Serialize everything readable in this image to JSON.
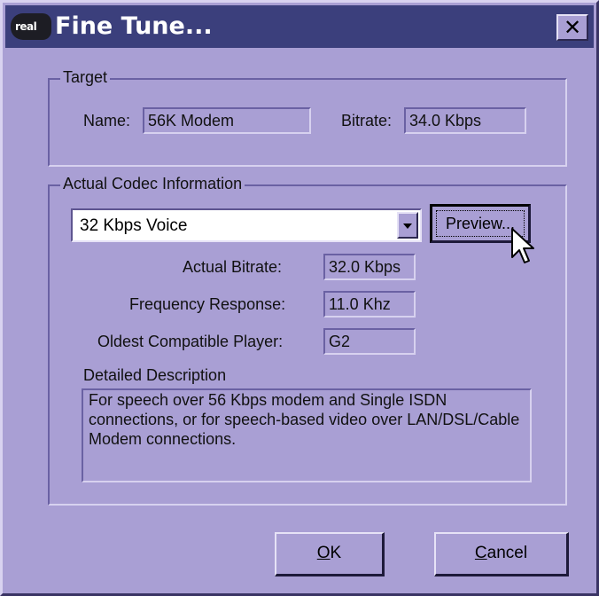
{
  "window": {
    "title": "Fine Tune...",
    "logo_text": "real",
    "close_glyph": "✕",
    "colors": {
      "dialog_bg": "#a99fd4",
      "titlebar_bg": "#3b3f7c",
      "title_text": "#ffffff"
    }
  },
  "target": {
    "group_label": "Target",
    "name_label": "Name:",
    "name_value": "56K Modem",
    "bitrate_label": "Bitrate:",
    "bitrate_value": "34.0 Kbps"
  },
  "codec": {
    "group_label": "Actual Codec Information",
    "selected_codec": "32 Kbps Voice",
    "preview_label": "Preview...",
    "actual_bitrate_label": "Actual Bitrate:",
    "actual_bitrate_value": "32.0 Kbps",
    "frequency_label": "Frequency Response:",
    "frequency_value": "11.0 Khz",
    "player_label": "Oldest Compatible Player:",
    "player_value": "G2",
    "description_label": "Detailed Description",
    "description_text": "For speech over 56 Kbps modem and Single ISDN connections, or for speech-based video over LAN/DSL/Cable Modem connections."
  },
  "buttons": {
    "ok_underlined": "O",
    "ok_rest": "K",
    "cancel_underlined": "C",
    "cancel_rest": "ancel"
  },
  "icons": {
    "logo": "realplayer-logo-icon",
    "close": "close-icon",
    "dropdown": "chevron-down-icon",
    "cursor": "mouse-pointer-icon"
  }
}
